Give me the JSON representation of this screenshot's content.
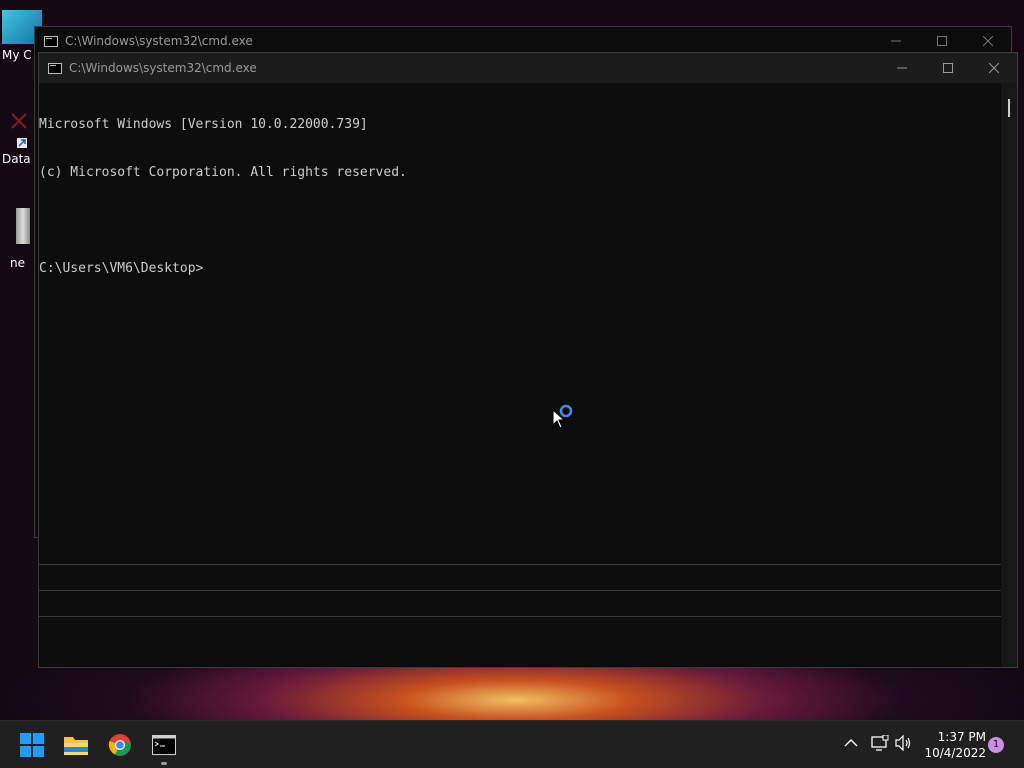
{
  "desktop": {
    "icons": [
      {
        "label": "My C"
      },
      {
        "label": "Data"
      },
      {
        "label": "ne"
      }
    ]
  },
  "window_back": {
    "title": "C:\\Windows\\system32\\cmd.exe"
  },
  "window_front": {
    "title": "C:\\Windows\\system32\\cmd.exe",
    "lines": [
      "Microsoft Windows [Version 10.0.22000.739]",
      "(c) Microsoft Corporation. All rights reserved.",
      "",
      "C:\\Users\\VM6\\Desktop>"
    ]
  },
  "taskbar": {
    "time": "1:37 PM",
    "date": "10/4/2022",
    "notification_count": "1",
    "icons": [
      "windows-start-icon",
      "file-explorer-icon",
      "chrome-icon",
      "terminal-icon"
    ]
  },
  "colors": {
    "console_bg": "#0c0c0c",
    "console_text": "#cccccc",
    "taskbar_bg": "#202020",
    "accent": "#0078d4",
    "badge": "#c890e8"
  }
}
